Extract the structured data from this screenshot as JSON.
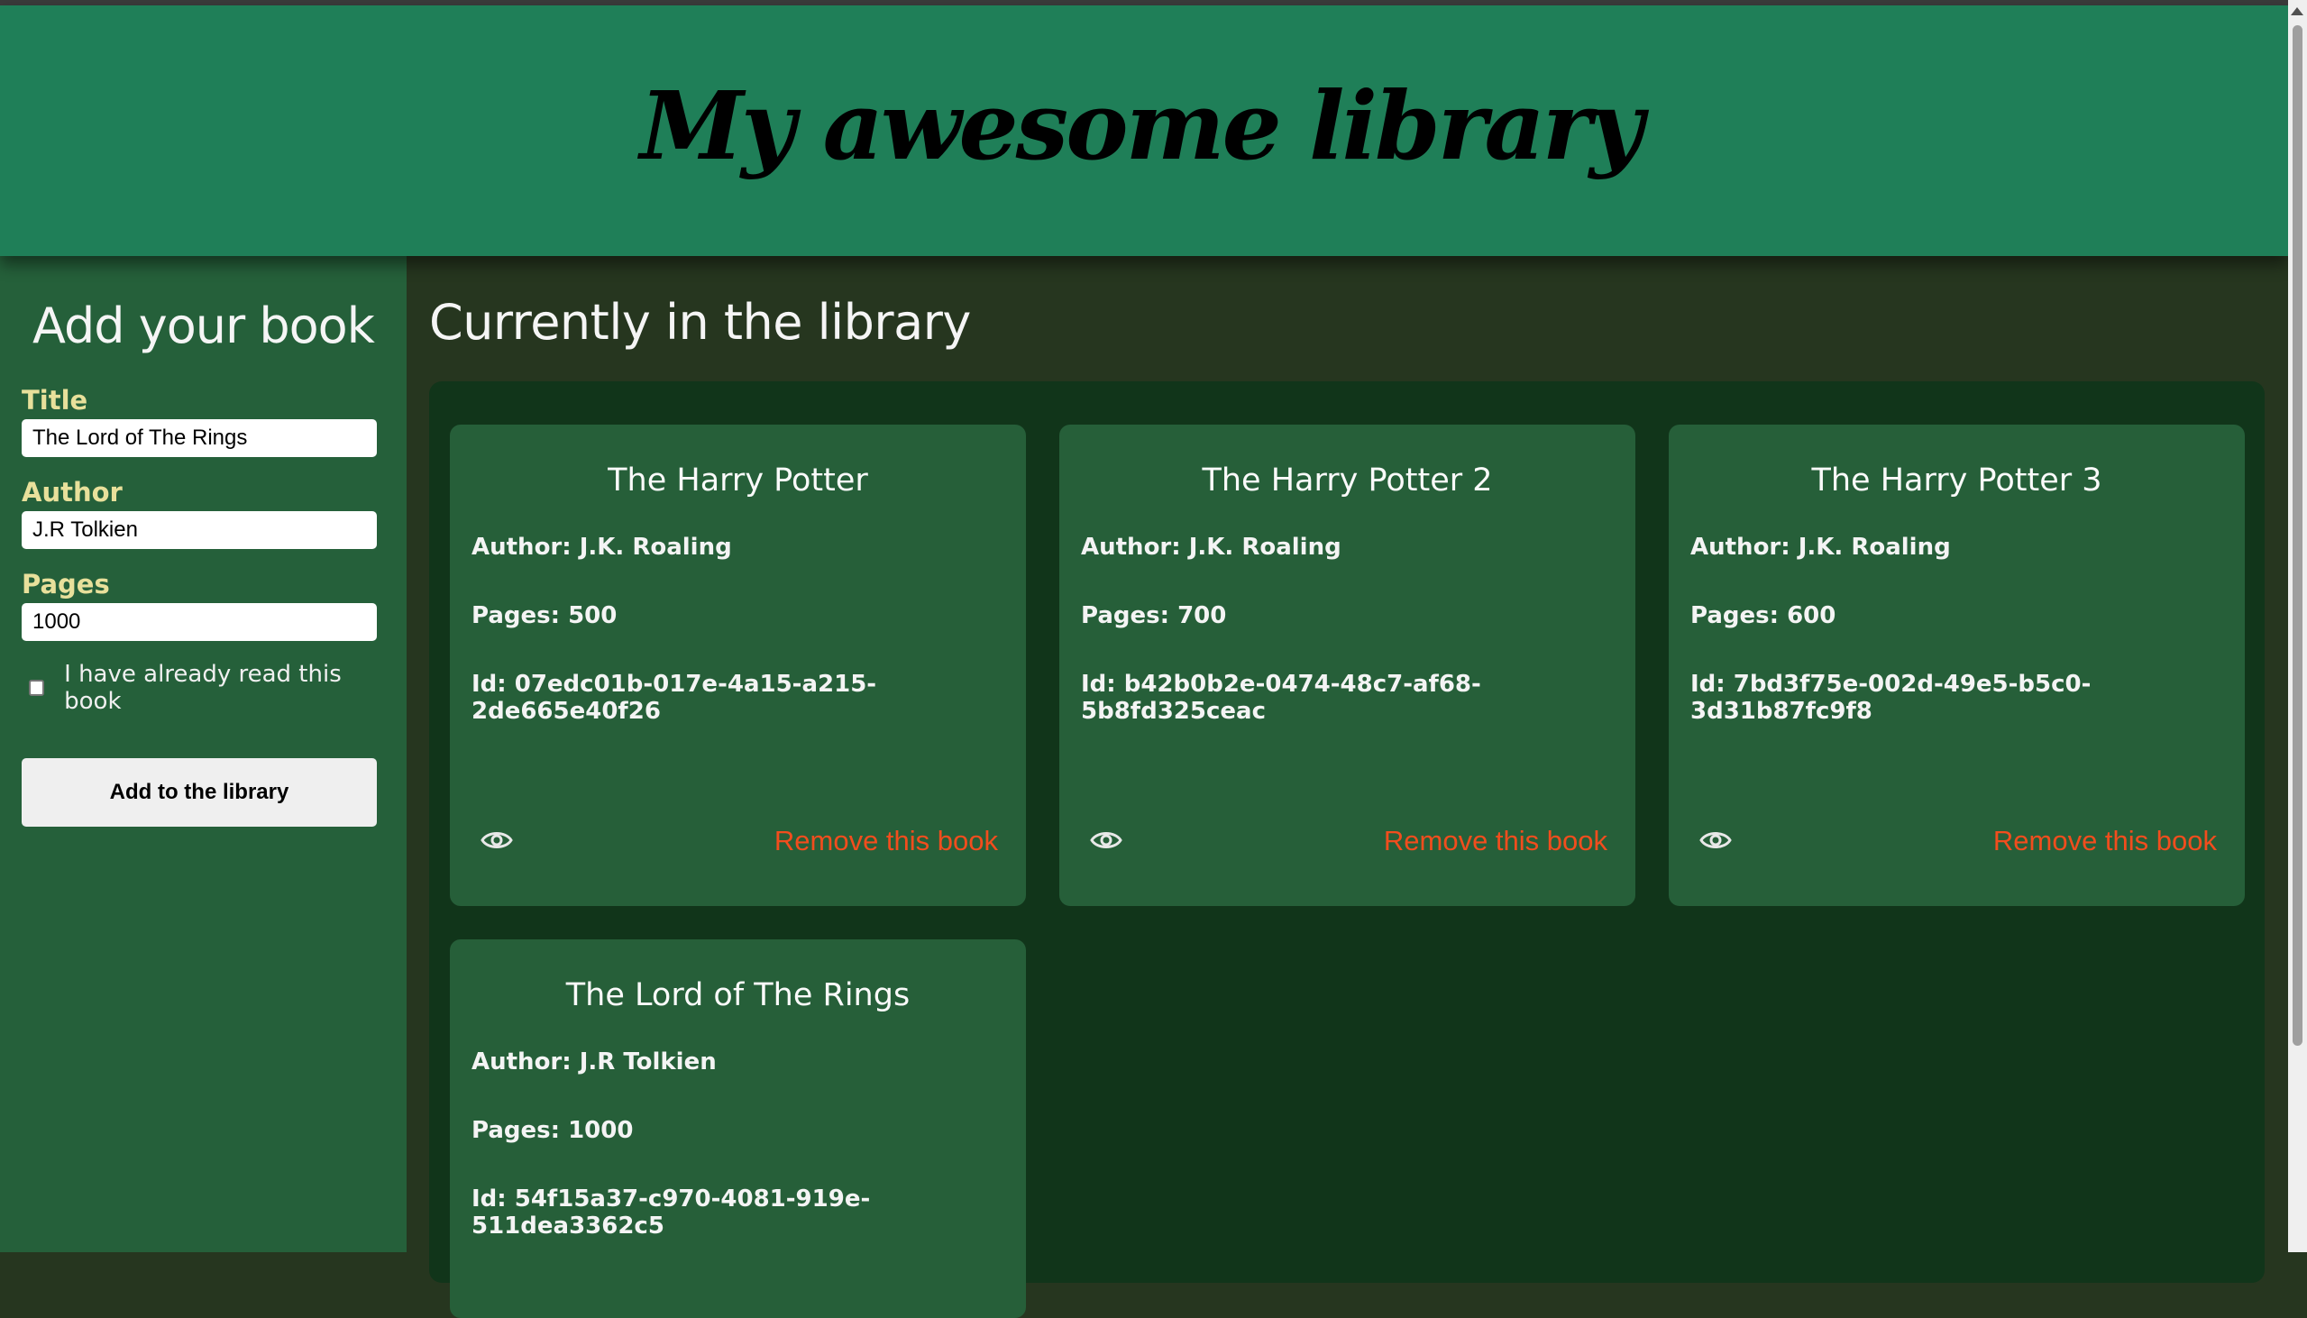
{
  "header": {
    "title": "My awesome library"
  },
  "form": {
    "heading": "Add your book",
    "title_label": "Title",
    "title_value": "The Lord of The Rings",
    "author_label": "Author",
    "author_value": "J.R Tolkien",
    "pages_label": "Pages",
    "pages_value": "1000",
    "read_label": "I have already read this book",
    "read_checked": false,
    "submit_label": "Add to the library"
  },
  "library": {
    "heading": "Currently in the library",
    "remove_label": "Remove this book",
    "books": [
      {
        "title": "The Harry Potter",
        "author": "Author: J.K. Roaling",
        "pages": "Pages: 500",
        "id": "Id: 07edc01b-017e-4a15-a215-2de665e40f26"
      },
      {
        "title": "The Harry Potter 2",
        "author": "Author: J.K. Roaling",
        "pages": "Pages: 700",
        "id": "Id: b42b0b2e-0474-48c7-af68-5b8fd325ceac"
      },
      {
        "title": "The Harry Potter 3",
        "author": "Author: J.K. Roaling",
        "pages": "Pages: 600",
        "id": "Id: 7bd3f75e-002d-49e5-b5c0-3d31b87fc9f8"
      },
      {
        "title": "The Lord of The Rings",
        "author": "Author: J.R Tolkien",
        "pages": "Pages: 1000",
        "id": "Id: 54f15a37-c970-4081-919e-511dea3362c5"
      }
    ]
  },
  "colors": {
    "header_bg": "#1f7f58",
    "sidebar_bg": "#25603a",
    "page_bg": "#26361f",
    "panel_bg": "#11351a",
    "card_bg": "#265f39",
    "label_color": "#e8e09b",
    "remove_color": "#f24d1d"
  },
  "icons": {
    "view": "eye-icon"
  }
}
